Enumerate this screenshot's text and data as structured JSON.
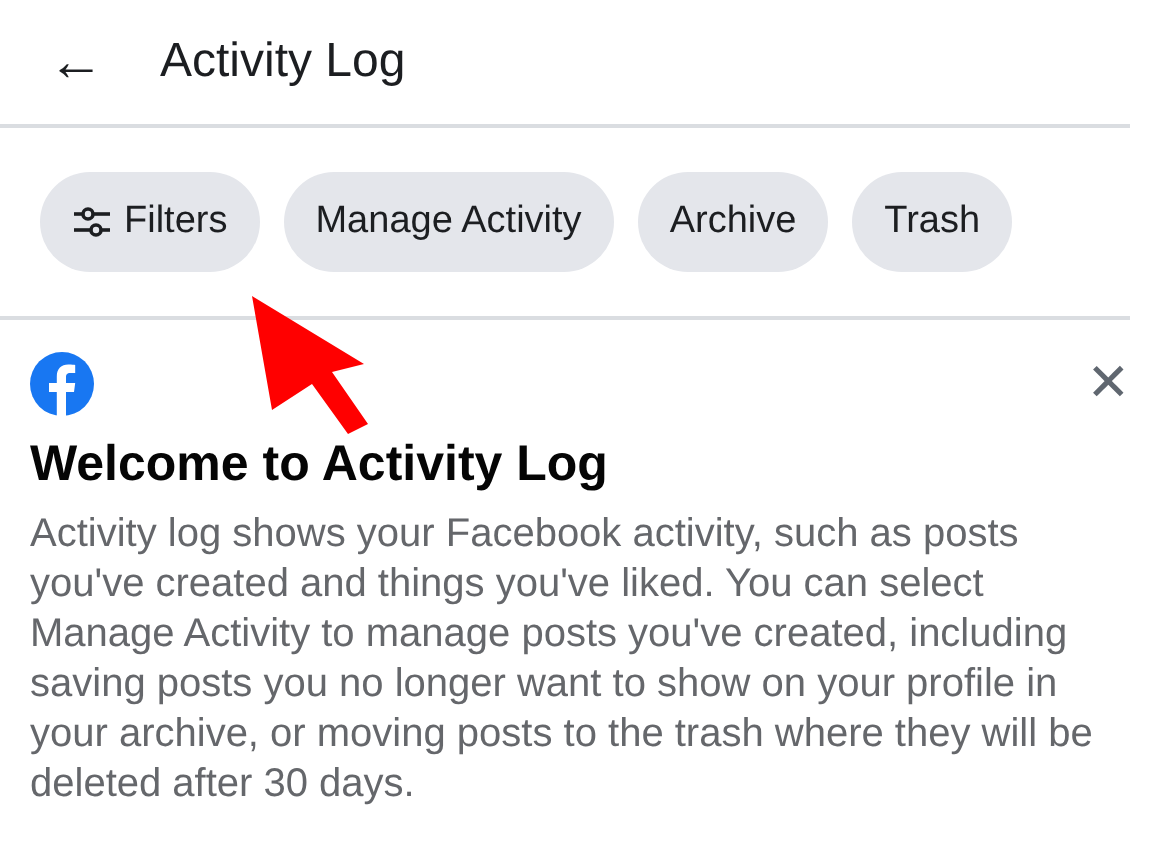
{
  "header": {
    "back": "←",
    "title": "Activity Log"
  },
  "chips": [
    {
      "label": "Filters",
      "kind": "filter"
    },
    {
      "label": "Manage Activity",
      "kind": "plain"
    },
    {
      "label": "Archive",
      "kind": "plain"
    },
    {
      "label": "Trash",
      "kind": "plain"
    }
  ],
  "card": {
    "title": "Welcome to Activity Log",
    "body": "Activity log shows your Facebook activity, such as posts you've created and things you've liked. You can select Manage Activity to manage posts you've created, including saving posts you no longer want to show on your profile in your archive, or moving posts to the trash where they will be deleted after 30 days.",
    "close": "✕"
  },
  "annotation": {
    "kind": "arrow"
  }
}
